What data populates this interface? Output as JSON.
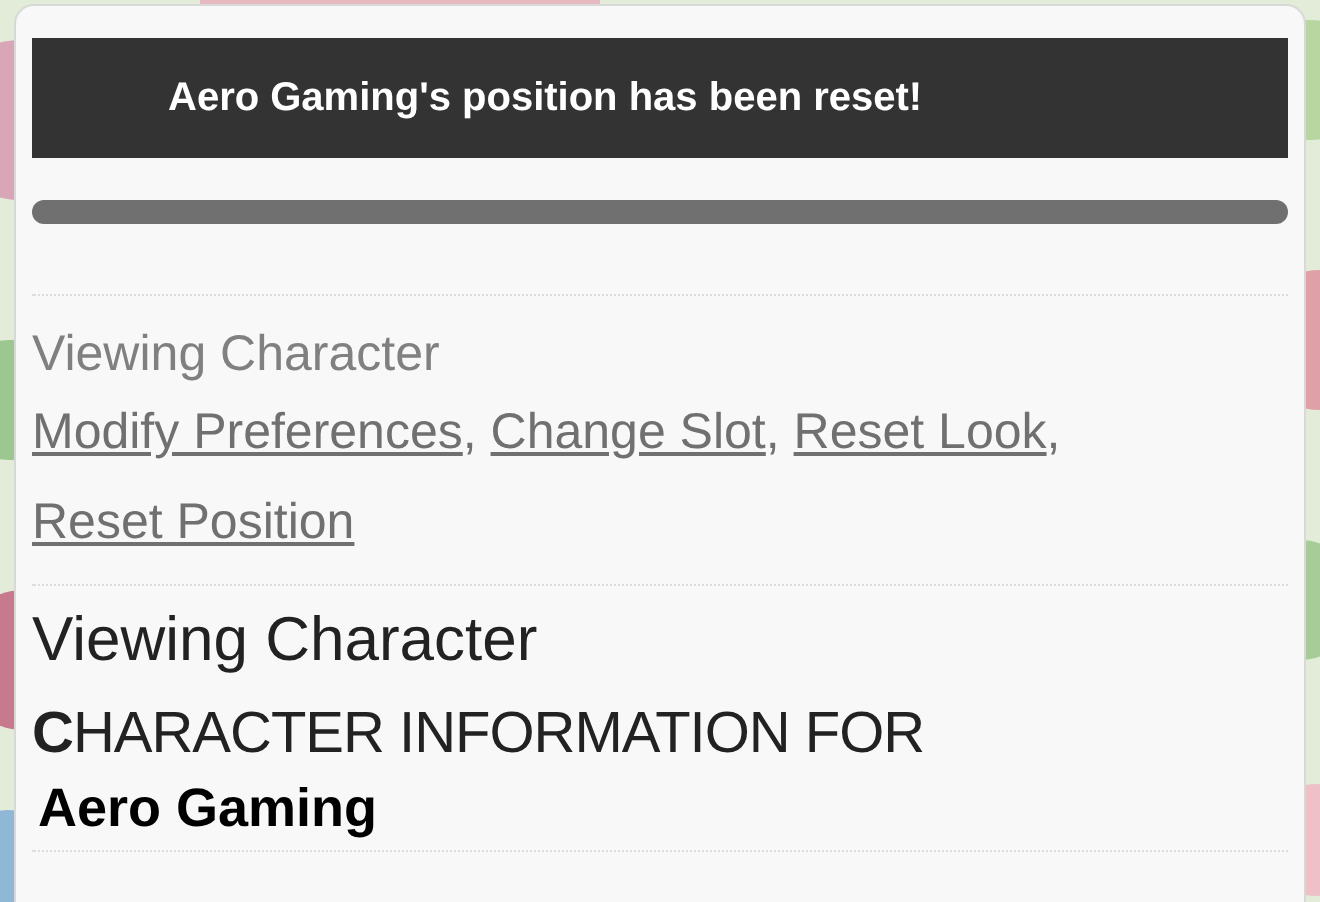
{
  "notice": {
    "message": "Aero Gaming's position has been reset!"
  },
  "breadcrumb": "Viewing Character",
  "links": [
    {
      "label": "Modify Preferences",
      "separator": ","
    },
    {
      "label": "Change Slot",
      "separator": ","
    },
    {
      "label": "Reset Look",
      "separator": ","
    },
    {
      "label": "Reset Position"
    }
  ],
  "heading": "Viewing Character",
  "subheading": "**C**HARACTER INFORMATION FOR",
  "character_name": "Aero Gaming"
}
